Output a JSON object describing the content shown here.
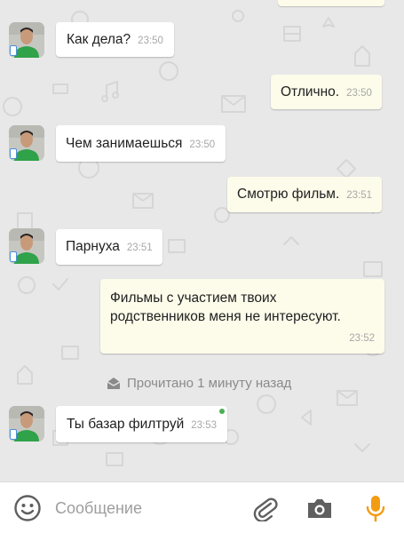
{
  "messages": [
    {
      "text": "Как дела?",
      "time": "23:50"
    },
    {
      "text": "Отлично.",
      "time": "23:50"
    },
    {
      "text": "Чем занимаешься",
      "time": "23:50"
    },
    {
      "text": "Смотрю фильм.",
      "time": "23:51"
    },
    {
      "text": "Парнуха",
      "time": "23:51"
    },
    {
      "text": "Фильмы с участием твоих родственников меня не интересуют.",
      "time": "23:52"
    },
    {
      "text": "Ты базар филтруй",
      "time": "23:53"
    }
  ],
  "read_status": "Прочитано 1 минуту назад",
  "composer": {
    "placeholder": "Сообщение"
  },
  "colors": {
    "incoming_bubble": "#ffffff",
    "outgoing_bubble": "#fdfbea",
    "chat_background": "#e8e8e8",
    "accent_mic": "#f39c12",
    "online_dot": "#4caf50"
  },
  "icons": {
    "composer": [
      "smiley-icon",
      "paperclip-icon",
      "camera-icon",
      "microphone-icon"
    ],
    "avatar_badge": "mobile-device-icon",
    "read_status": "open-envelope-icon"
  }
}
